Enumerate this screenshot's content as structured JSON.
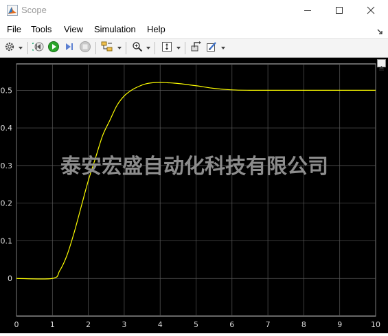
{
  "window": {
    "title": "Scope",
    "icon": "matlab-scope-icon",
    "controls": [
      "minimize-icon",
      "maximize-icon",
      "close-icon"
    ]
  },
  "menu": {
    "items": [
      "File",
      "Tools",
      "View",
      "Simulation",
      "Help"
    ]
  },
  "toolbar": {
    "buttons": [
      "settings-icon",
      "step-back-icon",
      "run-icon",
      "step-forward-icon",
      "stop-icon",
      "signal-selector-icon",
      "zoom-icon",
      "scale-axes-icon",
      "highlight-block-icon",
      "style-icon"
    ]
  },
  "colors": {
    "plot_background": "#000000",
    "axes_background": "#000000",
    "axes_color": "#ffffff",
    "grid_color": "#5a5a5a",
    "line_color": "#ffff00",
    "watermark_color": "#8c8c8c"
  },
  "watermark": "泰安宏盛自动化科技有限公司",
  "chart_data": {
    "type": "line",
    "title": "",
    "xlabel": "",
    "ylabel": "",
    "xlim": [
      0,
      10
    ],
    "ylim": [
      -0.1,
      0.57
    ],
    "xticks": [
      "0",
      "1",
      "2",
      "3",
      "4",
      "5",
      "6",
      "7",
      "8",
      "9",
      "10"
    ],
    "yticks": [
      "0",
      "0.1",
      "0.2",
      "0.3",
      "0.4",
      "0.5"
    ],
    "grid": true,
    "series": [
      {
        "x": [
          0,
          1.0,
          1.2,
          1.4,
          1.6,
          1.8,
          2.0,
          2.2,
          2.4,
          2.6,
          2.8,
          3.0,
          3.2,
          3.4,
          3.6,
          3.8,
          4.0,
          4.2,
          4.5,
          5.0,
          5.5,
          6.0,
          6.5,
          7.0,
          8.0,
          9.0,
          10.0
        ],
        "y": [
          0,
          0,
          0.02,
          0.06,
          0.12,
          0.19,
          0.26,
          0.32,
          0.38,
          0.42,
          0.46,
          0.485,
          0.5,
          0.51,
          0.517,
          0.52,
          0.521,
          0.52,
          0.518,
          0.512,
          0.505,
          0.501,
          0.5,
          0.5,
          0.5,
          0.5,
          0.5
        ]
      }
    ]
  }
}
